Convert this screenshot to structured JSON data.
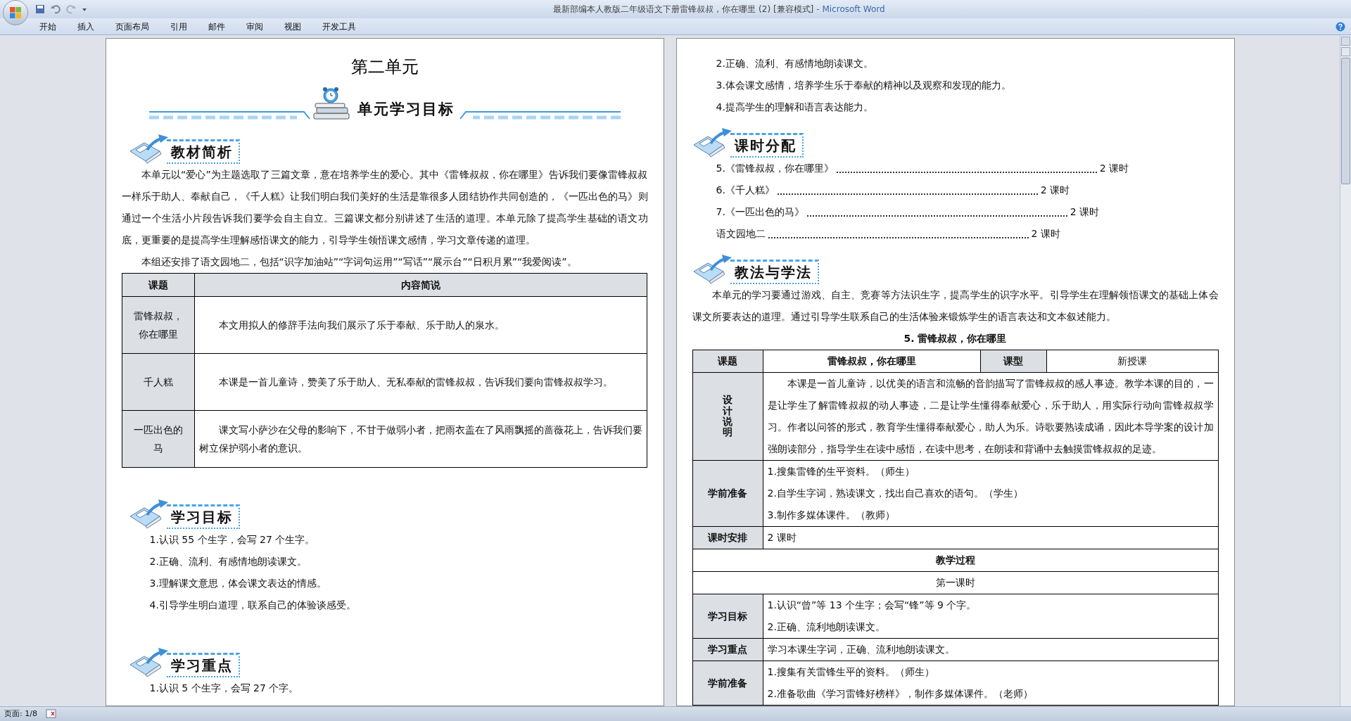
{
  "window": {
    "title": "最新部编本人教版二年级语文下册雷锋叔叔，你在哪里 (2) [兼容模式]",
    "app": "- Microsoft Word"
  },
  "ribbon_tabs": [
    "开始",
    "插入",
    "页面布局",
    "引用",
    "邮件",
    "审阅",
    "视图",
    "开发工具"
  ],
  "pages": [
    {
      "blocks": [
        {
          "kind": "title",
          "text": "第二单元"
        },
        {
          "kind": "banner",
          "text": "单元学习目标"
        },
        {
          "kind": "section",
          "text": "教材简析"
        },
        {
          "kind": "paragraph",
          "text": "本单元以“爱心”为主题选取了三篇文章，意在培养学生的爱心。其中《雷锋叔叔，你在哪里》告诉我们要像雷锋叔叔一样乐于助人、奉献自己，《千人糕》让我们明白我们美好的生活是靠很多人团结协作共同创造的，《一匹出色的马》则通过一个生活小片段告诉我们要学会自主自立。三篇课文都分别讲述了生活的道理。本单元除了提高学生基础的语文功底，更重要的是提高学生理解感悟课文的能力，引导学生领悟课文感情，学习文章传递的道理。"
        },
        {
          "kind": "paragraph",
          "text": "本组还安排了语文园地二，包括“识字加油站”“字词句运用”“写话”“展示台”“日积月累”“我爱阅读”。"
        },
        {
          "kind": "overview_table",
          "rows": [
            [
              {
                "text": "课题",
                "shaded": true,
                "bold": true
              },
              {
                "text": "内容简说",
                "shaded": true,
                "bold": true
              }
            ],
            [
              {
                "lines": [
                  "雷锋叔叔，",
                  "你在哪里"
                ],
                "shaded": true
              },
              {
                "paragraph": "本文用拟人的修辞手法向我们展示了乐于奉献、乐于助人的泉水。"
              }
            ],
            [
              {
                "text": "千人糕",
                "shaded": true
              },
              {
                "paragraph": "本课是一首儿童诗，赞美了乐于助人、无私奉献的雷锋叔叔，告诉我们要向雷锋叔叔学习。"
              }
            ],
            [
              {
                "lines": [
                  "一匹出色的",
                  "马"
                ],
                "shaded": true
              },
              {
                "paragraph": "课文写小萨沙在父母的影响下，不甘于做弱小者，把雨衣盖在了风雨飘摇的蔷薇花上，告诉我们要树立保护弱小者的意识。"
              }
            ]
          ]
        },
        {
          "kind": "blank"
        },
        {
          "kind": "section",
          "text": "学习目标"
        },
        {
          "kind": "list_item",
          "text": "1.认识 55 个生字，会写 27 个生字。"
        },
        {
          "kind": "list_item",
          "text": "2.正确、流利、有感情地朗读课文。"
        },
        {
          "kind": "list_item",
          "text": "3.理解课文意思，体会课文表达的情感。"
        },
        {
          "kind": "list_item",
          "text": "4.引导学生明白道理，联系自己的体验谈感受。"
        },
        {
          "kind": "blank"
        },
        {
          "kind": "section",
          "text": "学习重点"
        },
        {
          "kind": "list_item",
          "text": "1.认识 5 个生字，会写 27 个字。"
        }
      ]
    },
    {
      "blocks": [
        {
          "kind": "list_item",
          "text": "2.正确、流利、有感情地朗读课文。"
        },
        {
          "kind": "list_item",
          "text": "3.体会课文感情，培养学生乐于奉献的精神以及观察和发现的能力。"
        },
        {
          "kind": "list_item",
          "text": "4.提高学生的理解和语言表达能力。"
        },
        {
          "kind": "section",
          "text": "课时分配"
        },
        {
          "kind": "toc",
          "label": "5.《雷锋叔叔，你在哪里》",
          "value": "2 课时"
        },
        {
          "kind": "toc",
          "label": "6.《千人糕》",
          "value": "2 课时"
        },
        {
          "kind": "toc",
          "label": "7.《一匹出色的马》",
          "value": "2 课时"
        },
        {
          "kind": "toc",
          "label": "语文园地二",
          "value": "2 课时"
        },
        {
          "kind": "section",
          "text": "教法与学法"
        },
        {
          "kind": "paragraph",
          "text": "本单元的学习要通过游戏、自主、竞赛等方法识生字，提高学生的识字水平。引导学生在理解领悟课文的基础上体会课文所要表达的道理。通过引导学生联系自己的生活体验来锻炼学生的语言表达和文本叙述能力。"
        },
        {
          "kind": "subtitle",
          "text": "5. 雷锋叔叔，你在哪里"
        },
        {
          "kind": "lesson_table",
          "parts": [
            {
              "rows": [
                [
                  {
                    "text": "课题",
                    "shaded": true,
                    "bold": true
                  },
                  {
                    "text": "雷锋叔叔，你在哪里",
                    "bold": true
                  },
                  {
                    "text": "课型",
                    "shaded": true,
                    "bold": true
                  },
                  {
                    "text": "新授课"
                  }
                ]
              ]
            },
            {
              "rows": [
                [
                  {
                    "text": "设计说明",
                    "shaded": true,
                    "bold": true,
                    "vertical": true
                  },
                  {
                    "paragraph": "本课是一首儿童诗，以优美的语言和流畅的音韵描写了雷锋叔叔的感人事迹。教学本课的目的，一是让学生了解雷锋叔叔的动人事迹，二是让学生懂得奉献爱心，乐于助人，用实际行动向雷锋叔叔学习。作者以问答的形式，教育学生懂得奉献爱心，助人为乐。诗歌要熟读成诵，因此本导学案的设计加强朗读部分，指导学生在读中感悟，在读中思考，在朗读和背诵中去触摸雷锋叔叔的足迹。"
                  }
                ],
                [
                  {
                    "text": "学前准备",
                    "shaded": true,
                    "bold": true
                  },
                  {
                    "lines": [
                      "1.搜集雷锋的生平资料。（师生）",
                      "2.自学生字词，熟读课文，找出自己喜欢的语句。（学生）",
                      "3.制作多媒体课件。（教师）"
                    ]
                  }
                ],
                [
                  {
                    "text": "课时安排",
                    "shaded": true,
                    "bold": true
                  },
                  {
                    "text": "2 课时"
                  }
                ]
              ]
            },
            {
              "rows": [
                [
                  {
                    "text": "教学过程",
                    "bold": true
                  }
                ],
                [
                  {
                    "text": "第一课时"
                  }
                ]
              ]
            },
            {
              "rows": [
                [
                  {
                    "text": "学习目标",
                    "shaded": true,
                    "bold": true
                  },
                  {
                    "lines": [
                      "1.认识“曾”等 13 个生字；会写“锋”等 9 个字。",
                      "2.正确、流利地朗读课文。"
                    ]
                  }
                ],
                [
                  {
                    "text": "学习重点",
                    "shaded": true,
                    "bold": true
                  },
                  {
                    "text": "学习本课生字词，正确、流利地朗读课文。"
                  }
                ],
                [
                  {
                    "text": "学前准备",
                    "shaded": true,
                    "bold": true
                  },
                  {
                    "lines": [
                      "1.搜集有关雷锋生平的资料。（师生）",
                      "2.准备歌曲《学习雷锋好榜样》，制作多媒体课件。（老师）"
                    ]
                  }
                ]
              ]
            }
          ]
        }
      ]
    }
  ],
  "status_bar": {
    "page": "页面: 1/8"
  }
}
